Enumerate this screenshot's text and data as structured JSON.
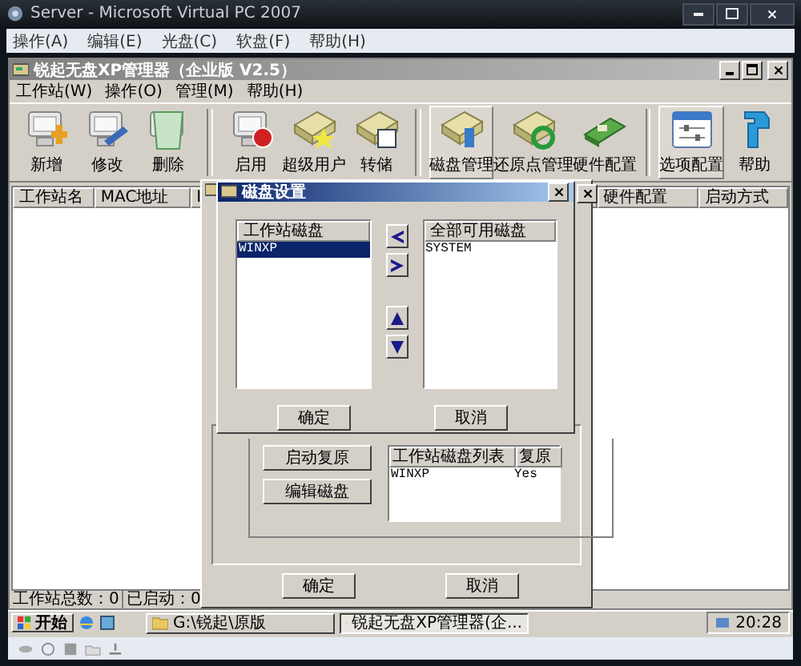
{
  "host_window": {
    "title": "Server - Microsoft Virtual PC 2007",
    "menu": [
      "操作(A)",
      "编辑(E)",
      "光盘(C)",
      "软盘(F)",
      "帮助(H)"
    ]
  },
  "app": {
    "title": "锐起无盘XP管理器（企业版 V2.5）",
    "menu": [
      "工作站(W)",
      "操作(O)",
      "管理(M)",
      "帮助(H)"
    ],
    "toolbar": [
      [
        {
          "label": "新增",
          "pressed": false
        },
        {
          "label": "修改",
          "pressed": false
        },
        {
          "label": "删除",
          "pressed": false
        }
      ],
      [
        {
          "label": "启用",
          "pressed": false
        },
        {
          "label": "超级用户",
          "pressed": false
        },
        {
          "label": "转储",
          "pressed": false
        }
      ],
      [
        {
          "label": "磁盘管理",
          "pressed": true
        },
        {
          "label": "还原点管理",
          "pressed": false
        },
        {
          "label": "硬件配置",
          "pressed": false
        }
      ],
      [
        {
          "label": "选项配置",
          "pressed": true
        },
        {
          "label": "帮助",
          "pressed": false
        }
      ]
    ],
    "table": {
      "columns": [
        "工作站名",
        "MAC地址",
        "I",
        "硬件配置",
        "启动方式"
      ]
    },
    "status_bar": [
      "工作站总数：0",
      "已启动：0"
    ]
  },
  "disk_dialog": {
    "side_buttons": [
      "启动复原",
      "编辑磁盘"
    ],
    "list": {
      "columns": [
        "工作站磁盘列表",
        "复原"
      ],
      "rows": [
        [
          "WINXP",
          "Yes"
        ]
      ]
    },
    "buttons": [
      "确定",
      "取消"
    ]
  },
  "disk_settings": {
    "title": "磁盘设置",
    "left_list": {
      "header": "工作站磁盘",
      "items": [
        {
          "text": "WINXP",
          "selected": true
        }
      ]
    },
    "right_list": {
      "header": "全部可用磁盘",
      "items": [
        {
          "text": "SYSTEM",
          "selected": false
        }
      ]
    },
    "buttons": [
      "确定",
      "取消"
    ]
  },
  "taskbar": {
    "start": "开始",
    "tasks": [
      {
        "label": "G:\\锐起\\原版",
        "selected": false
      },
      {
        "label": "锐起无盘XP管理器(企...",
        "selected": true
      }
    ],
    "clock": "20:28"
  }
}
